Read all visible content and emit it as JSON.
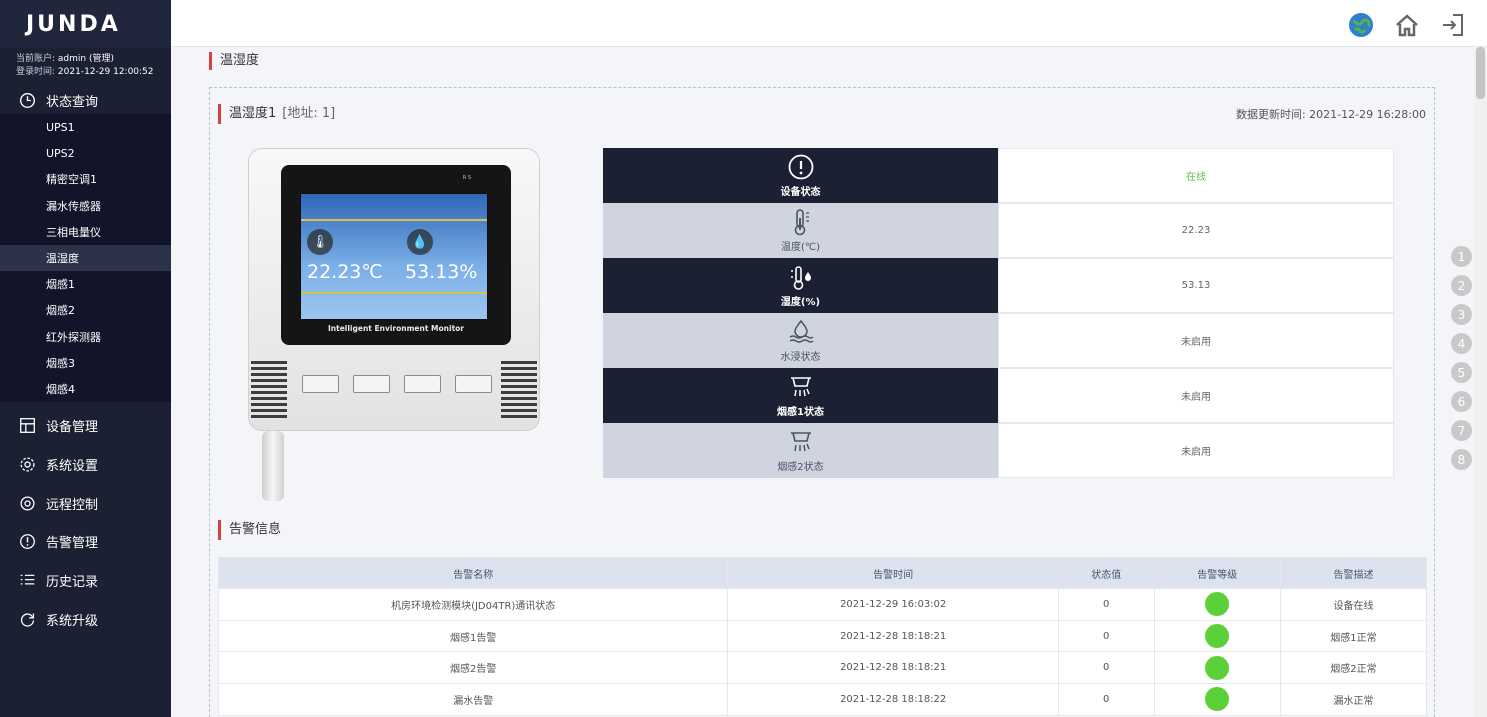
{
  "app": {
    "logo_text": "JUNDA"
  },
  "account": {
    "user_label": "当前账户:",
    "user_value": "admin (管理)",
    "login_label": "登录时间:",
    "login_value": "2021-12-29 12:00:52"
  },
  "sidebar": {
    "status_group": "状态查询",
    "status_items": [
      "UPS1",
      "UPS2",
      "精密空调1",
      "漏水传感器",
      "三相电量仪",
      "温湿度",
      "烟感1",
      "烟感2",
      "红外探测器",
      "烟感3",
      "烟感4"
    ],
    "active_item": "温湿度",
    "main_items": [
      {
        "label": "设备管理",
        "icon": "device-manage-icon"
      },
      {
        "label": "系统设置",
        "icon": "gear-icon"
      },
      {
        "label": "远程控制",
        "icon": "remote-control-icon"
      },
      {
        "label": "告警管理",
        "icon": "alert-icon"
      },
      {
        "label": "历史记录",
        "icon": "list-icon"
      },
      {
        "label": "系统升级",
        "icon": "refresh-icon"
      }
    ]
  },
  "topbar": {
    "icons": [
      "globe-icon",
      "home-icon",
      "logout-icon"
    ]
  },
  "page": {
    "section_title": "温湿度",
    "panel_title": "温湿度1",
    "panel_address": "[地址: 1]",
    "update_time": "数据更新时间: 2021-12-29 16:28:00"
  },
  "device_image": {
    "temp": "22.23℃",
    "humidity": "53.13%",
    "caption": "Intelligent Environment Monitor",
    "rs": "R    S"
  },
  "status": [
    {
      "label": "设备状态",
      "value": "在线",
      "icon": "info-circle-icon",
      "style": "dark"
    },
    {
      "label": "温度(℃)",
      "value": "22.23",
      "icon": "thermometer-icon",
      "style": "light"
    },
    {
      "label": "湿度(%)",
      "value": "53.13",
      "icon": "humidity-icon",
      "style": "dark"
    },
    {
      "label": "水浸状态",
      "value": "未启用",
      "icon": "water-leak-icon",
      "style": "light"
    },
    {
      "label": "烟感1状态",
      "value": "未启用",
      "icon": "smoke-detector-icon",
      "style": "dark"
    },
    {
      "label": "烟感2状态",
      "value": "未启用",
      "icon": "smoke-detector-icon",
      "style": "light"
    }
  ],
  "alarm": {
    "title": "告警信息",
    "headers": [
      "告警名称",
      "告警时间",
      "状态值",
      "告警等级",
      "告警描述"
    ],
    "rows": [
      {
        "name": "机房环境检测模块(JD04TR)通讯状态",
        "time": "2021-12-29 16:03:02",
        "value": "0",
        "level_color": "#5bd038",
        "desc": "设备在线"
      },
      {
        "name": "烟感1告警",
        "time": "2021-12-28 18:18:21",
        "value": "0",
        "level_color": "#5bd038",
        "desc": "烟感1正常"
      },
      {
        "name": "烟感2告警",
        "time": "2021-12-28 18:18:21",
        "value": "0",
        "level_color": "#5bd038",
        "desc": "烟感2正常"
      },
      {
        "name": "漏水告警",
        "time": "2021-12-28 18:18:22",
        "value": "0",
        "level_color": "#5bd038",
        "desc": "漏水正常"
      }
    ]
  },
  "anchors": [
    "1",
    "2",
    "3",
    "4",
    "5",
    "6",
    "7",
    "8"
  ]
}
